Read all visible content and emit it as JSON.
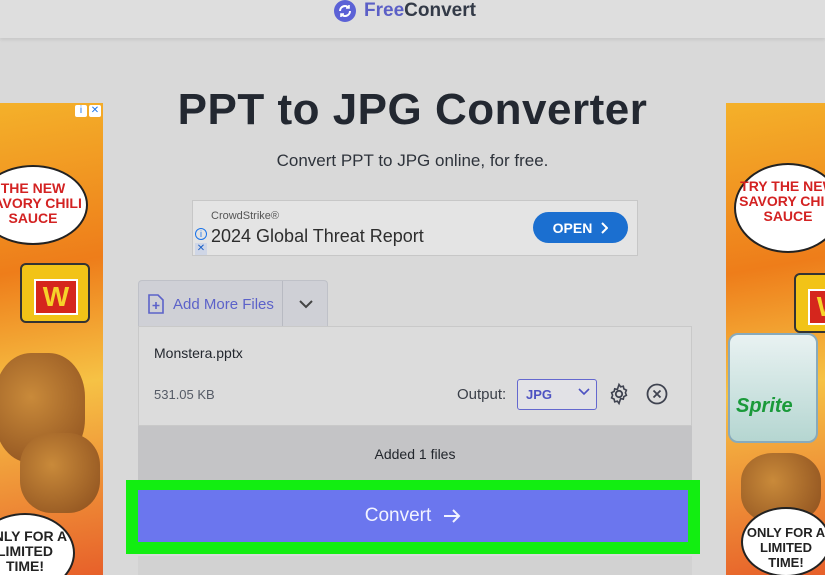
{
  "header": {
    "logo_part1": "Free",
    "logo_part2": "Convert"
  },
  "page": {
    "title": "PPT to JPG Converter",
    "subtitle": "Convert PPT to JPG online, for free."
  },
  "banner_ad": {
    "brand": "CrowdStrike®",
    "headline": "2024 Global Threat Report",
    "cta": "OPEN",
    "info_glyph": "i",
    "close_glyph": "✕"
  },
  "side_ads": {
    "corner_info": "i",
    "corner_close": "✕",
    "left_top_text": "THE NEW SAVORY CHILI SAUCE",
    "right_top_text": "TRY THE NEW SAVORY CHILI SAUCE",
    "sauce_logo": "W",
    "sprite_text": "Sprite",
    "bottom_text": "ONLY FOR A LIMITED TIME!"
  },
  "upload": {
    "add_more_label": "Add More Files",
    "file_name": "Monstera.pptx",
    "file_size": "531.05 KB",
    "output_label": "Output:",
    "output_value": "JPG",
    "added_status": "Added 1 files",
    "convert_label": "Convert"
  },
  "colors": {
    "accent": "#6b76ee",
    "brand": "#5b5fc6",
    "highlight": "#12ee11",
    "ad_button": "#1b6fd0"
  }
}
